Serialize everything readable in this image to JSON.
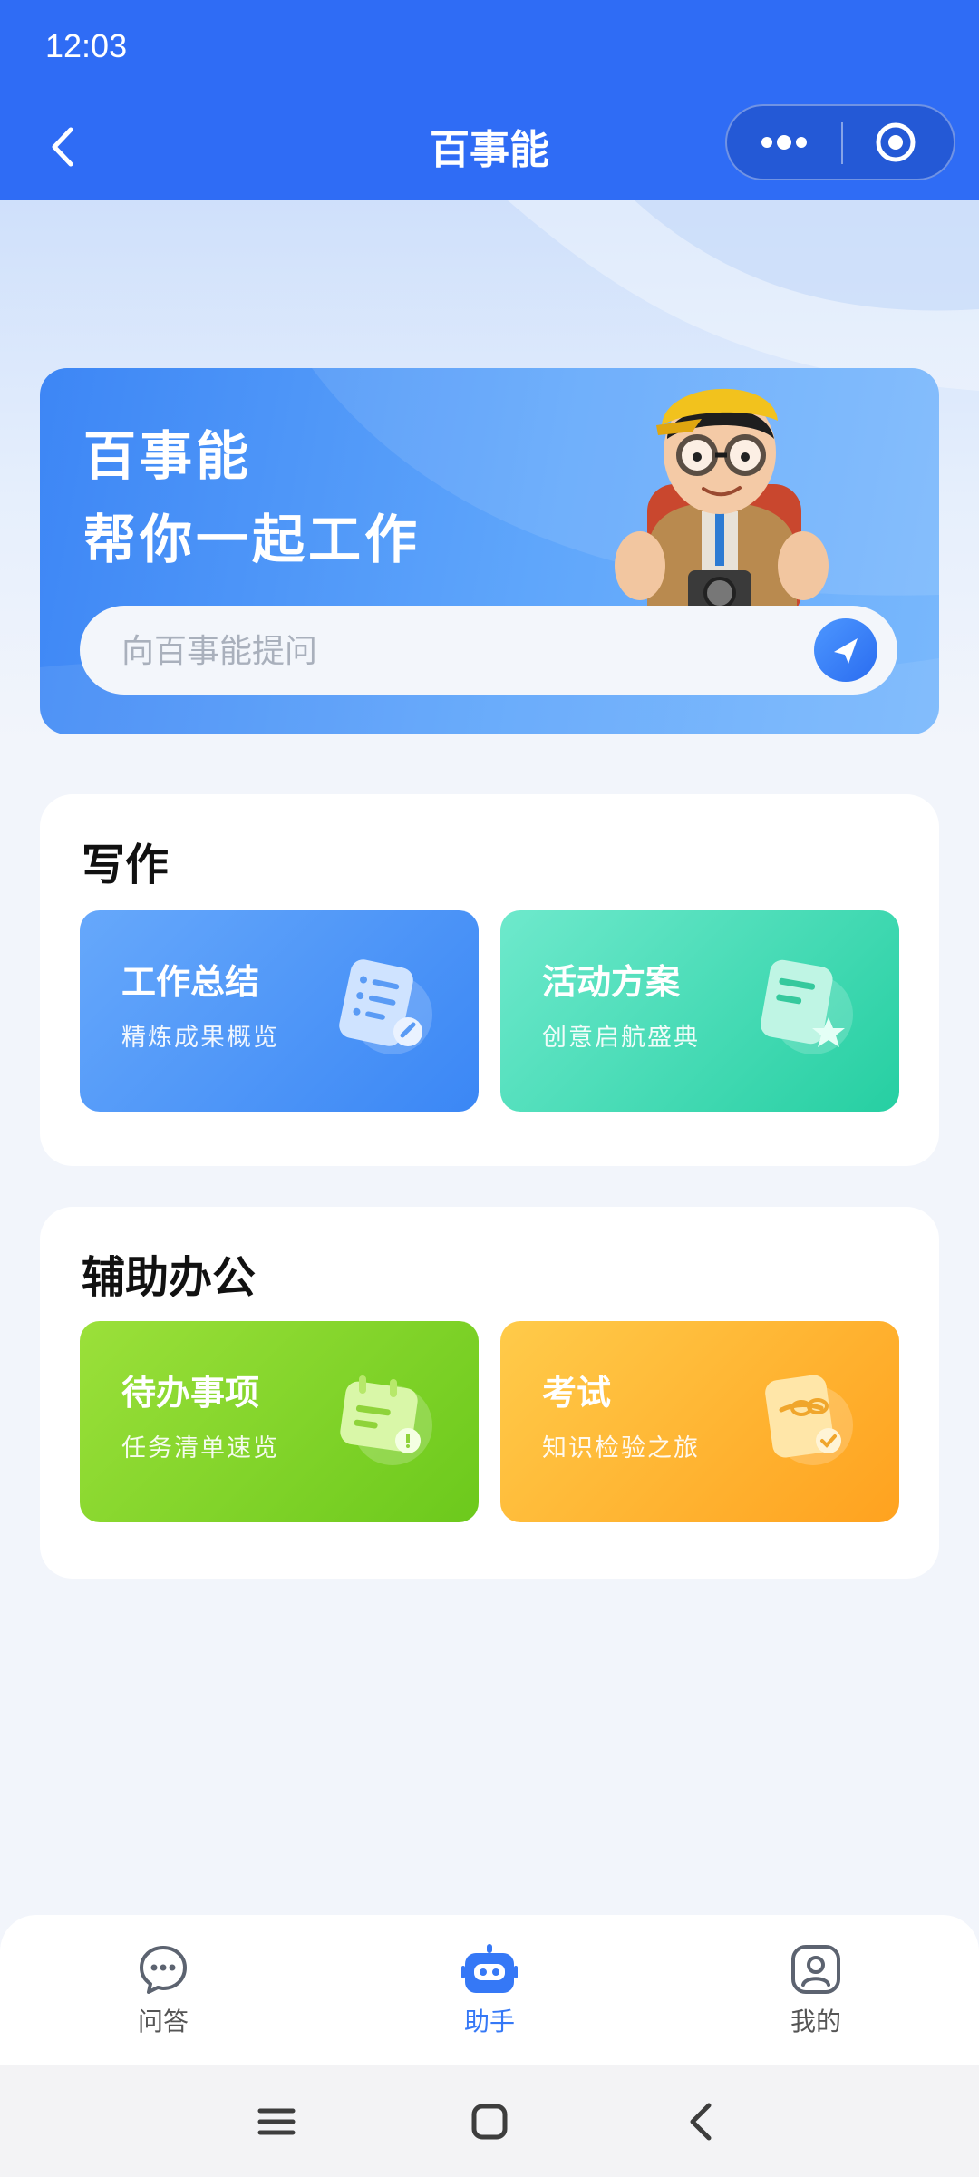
{
  "status_bar": {
    "time": "12:03"
  },
  "nav": {
    "title": "百事能"
  },
  "hero": {
    "title": "百事能",
    "subtitle": "帮你一起工作",
    "search_placeholder": "向百事能提问"
  },
  "sections": [
    {
      "title": "写作",
      "cards": [
        {
          "title": "工作总结",
          "desc": "精炼成果概览",
          "icon": "document-list-icon",
          "color": "#4f95f7"
        },
        {
          "title": "活动方案",
          "desc": "创意启航盛典",
          "icon": "star-document-icon",
          "color": "#2fd3a9"
        }
      ]
    },
    {
      "title": "辅助办公",
      "cards": [
        {
          "title": "待办事项",
          "desc": "任务清单速览",
          "icon": "calendar-icon",
          "color": "#7fd12a"
        },
        {
          "title": "考试",
          "desc": "知识检验之旅",
          "icon": "exam-scroll-icon",
          "color": "#ffad2a"
        }
      ]
    }
  ],
  "tab_bar": {
    "items": [
      {
        "label": "问答",
        "icon": "chat-icon"
      },
      {
        "label": "助手",
        "icon": "robot-icon",
        "active": true
      },
      {
        "label": "我的",
        "icon": "profile-icon"
      }
    ]
  },
  "colors": {
    "primary": "#2f6cf5",
    "active_tab": "#3578f6"
  }
}
